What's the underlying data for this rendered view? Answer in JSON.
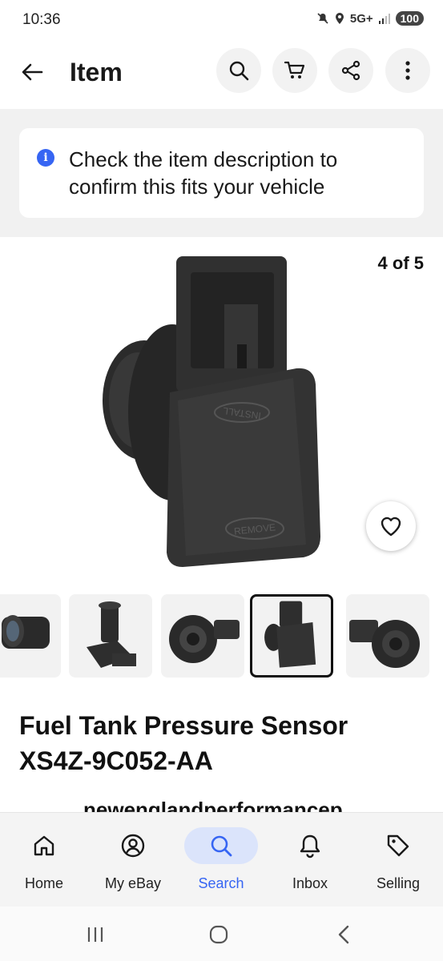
{
  "status_bar": {
    "time": "10:36",
    "network": "5G+",
    "battery": "100"
  },
  "header": {
    "title": "Item",
    "icons": [
      "arrow-left-icon",
      "search-icon",
      "cart-icon",
      "share-icon",
      "more-vertical-icon"
    ]
  },
  "fit_banner": {
    "icon": "info-icon",
    "text": "Check the item description to confirm this fits your vehicle"
  },
  "gallery": {
    "counter": "4 of 5",
    "current_index": 4,
    "total": 5,
    "watch_icon": "heart-icon"
  },
  "item": {
    "title": "Fuel Tank Pressure Sensor XS4Z-9C052-AA",
    "seller_partial": "newenglandperformancep"
  },
  "bottom_nav": {
    "items": [
      {
        "label": "Home",
        "icon": "home-icon"
      },
      {
        "label": "My eBay",
        "icon": "user-icon"
      },
      {
        "label": "Search",
        "icon": "search-icon"
      },
      {
        "label": "Inbox",
        "icon": "bell-icon"
      },
      {
        "label": "Selling",
        "icon": "tag-icon"
      }
    ],
    "active": "Search"
  },
  "colors": {
    "accent": "#3665f3",
    "active_pill": "#dbe4fb",
    "banner_bg": "#f1f1f1",
    "nav_bg": "#f4f4f4"
  }
}
